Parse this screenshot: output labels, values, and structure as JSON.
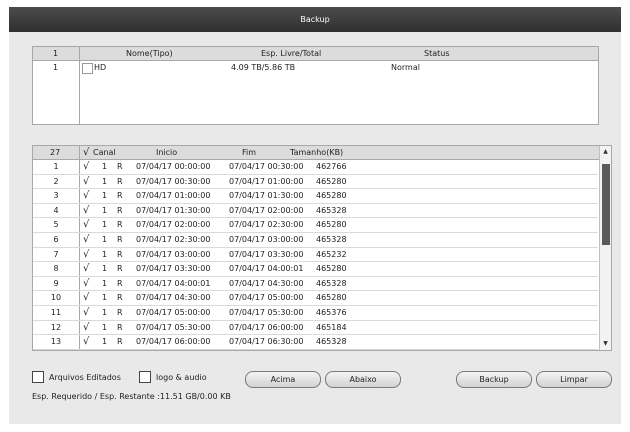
{
  "window": {
    "title": "Backup"
  },
  "devices": {
    "headers": [
      "1",
      "Nome(Tipo)",
      "Esp. Livre/Total",
      "Status"
    ],
    "rows": [
      {
        "index": "1",
        "name": "HD",
        "space": "4.09 TB/5.86 TB",
        "status": "Normal"
      }
    ]
  },
  "files": {
    "count": "27",
    "headers": {
      "check": "√",
      "channel": "Canal",
      "start": "Inicio",
      "end": "Fim",
      "size": "Tamanho(KB)"
    },
    "rows": [
      {
        "index": "1",
        "check": "√",
        "channel": "1",
        "type": "R",
        "start": "07/04/17 00:00:00",
        "end": "07/04/17 00:30:00",
        "size": "462766"
      },
      {
        "index": "2",
        "check": "√",
        "channel": "1",
        "type": "R",
        "start": "07/04/17 00:30:00",
        "end": "07/04/17 01:00:00",
        "size": "465280"
      },
      {
        "index": "3",
        "check": "√",
        "channel": "1",
        "type": "R",
        "start": "07/04/17 01:00:00",
        "end": "07/04/17 01:30:00",
        "size": "465280"
      },
      {
        "index": "4",
        "check": "√",
        "channel": "1",
        "type": "R",
        "start": "07/04/17 01:30:00",
        "end": "07/04/17 02:00:00",
        "size": "465328"
      },
      {
        "index": "5",
        "check": "√",
        "channel": "1",
        "type": "R",
        "start": "07/04/17 02:00:00",
        "end": "07/04/17 02:30:00",
        "size": "465280"
      },
      {
        "index": "6",
        "check": "√",
        "channel": "1",
        "type": "R",
        "start": "07/04/17 02:30:00",
        "end": "07/04/17 03:00:00",
        "size": "465328"
      },
      {
        "index": "7",
        "check": "√",
        "channel": "1",
        "type": "R",
        "start": "07/04/17 03:00:00",
        "end": "07/04/17 03:30:00",
        "size": "465232"
      },
      {
        "index": "8",
        "check": "√",
        "channel": "1",
        "type": "R",
        "start": "07/04/17 03:30:00",
        "end": "07/04/17 04:00:01",
        "size": "465280"
      },
      {
        "index": "9",
        "check": "√",
        "channel": "1",
        "type": "R",
        "start": "07/04/17 04:00:01",
        "end": "07/04/17 04:30:00",
        "size": "465328"
      },
      {
        "index": "10",
        "check": "√",
        "channel": "1",
        "type": "R",
        "start": "07/04/17 04:30:00",
        "end": "07/04/17 05:00:00",
        "size": "465280"
      },
      {
        "index": "11",
        "check": "√",
        "channel": "1",
        "type": "R",
        "start": "07/04/17 05:00:00",
        "end": "07/04/17 05:30:00",
        "size": "465376"
      },
      {
        "index": "12",
        "check": "√",
        "channel": "1",
        "type": "R",
        "start": "07/04/17 05:30:00",
        "end": "07/04/17 06:00:00",
        "size": "465184"
      },
      {
        "index": "13",
        "check": "√",
        "channel": "1",
        "type": "R",
        "start": "07/04/17 06:00:00",
        "end": "07/04/17 06:30:00",
        "size": "465328"
      }
    ]
  },
  "options": {
    "edited_files": "Arquivos Editados",
    "logo_audio": "logo & audio"
  },
  "buttons": {
    "up": "Acima",
    "down": "Abaixo",
    "backup": "Backup",
    "clear": "Limpar"
  },
  "status": {
    "space_text": "Esp. Requerido / Esp. Restante  :11.51 GB/0.00 KB"
  },
  "icons": {
    "scroll_up": "▲",
    "scroll_down": "▼"
  }
}
